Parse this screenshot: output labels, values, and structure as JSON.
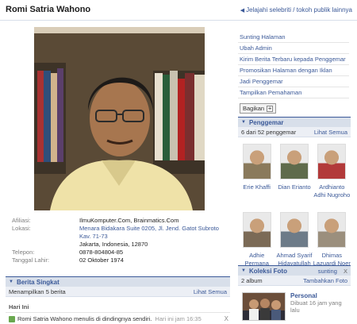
{
  "header": {
    "title": "Romi Satria Wahono",
    "back_link": "Jelajahi selebriti / tokoh publik lainnya"
  },
  "info": {
    "rows": [
      {
        "label": "Afiliasi:",
        "value": "IlmuKomputer.Com, Brainmatics.Com"
      },
      {
        "label": "Lokasi:",
        "value": "Menara Bidakara Suite 0205, Jl. Jend. Gatot Subroto Kav. 71-73"
      },
      {
        "label": "",
        "value": "Jakarta, Indonesia, 12870"
      },
      {
        "label": "Telepon:",
        "value": "0878-804804-85"
      },
      {
        "label": "Tanggal Lahir:",
        "value": "02 Oktober 1974"
      }
    ]
  },
  "wall": {
    "title": "Berita Singkat",
    "showing": "Menampilkan 5 berita",
    "see_all": "Lihat Semua",
    "today": "Hari Ini",
    "story": "Romi Satria Wahono menulis di dindingnya sendiri.",
    "story_time": "Hari ini jam 16:35",
    "close": "X"
  },
  "sidebar": {
    "links": [
      "Sunting Halaman",
      "Ubah Admin",
      "Kirim Berita Terbaru kepada Penggemar",
      "Promosikan Halaman dengan Iklan",
      "Jadi Penggemar",
      "Tampilkan Pemahaman"
    ],
    "share_button": "Bagikan"
  },
  "fans": {
    "title": "Penggemar",
    "count": "6 dari 52 penggemar",
    "see_all": "Lihat Semua",
    "people": [
      {
        "name": "Erie Khaffi",
        "color": "#8a7a5c"
      },
      {
        "name": "Dian Erianto",
        "color": "#5f6b4c"
      },
      {
        "name": "Ardhianto Adhi Nugroho",
        "color": "#b23a3a"
      },
      {
        "name": "Adhie Permana",
        "color": "#7b6a56"
      },
      {
        "name": "Ahmad Syarif Hidayatullah",
        "color": "#6d7b88"
      },
      {
        "name": "Dhimas Lazuardi Noer",
        "color": "#9b8f7d"
      }
    ]
  },
  "photos": {
    "title": "Koleksi Foto",
    "edit": "sunting",
    "close": "X",
    "album_count": "2 album",
    "add": "Tambahkan Foto",
    "album": {
      "name": "Personal",
      "meta": "Dibuat 16 jam yang lalu"
    }
  }
}
